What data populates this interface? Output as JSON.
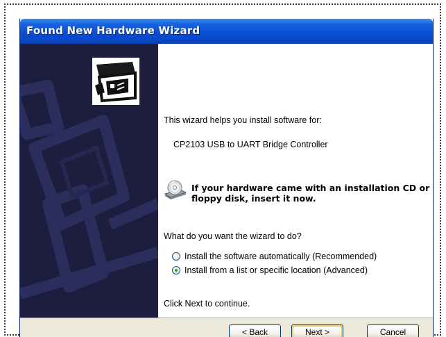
{
  "window": {
    "title": "Found New Hardware Wizard"
  },
  "content": {
    "intro": "This wizard helps you install software for:",
    "device_name": "CP2103 USB to UART Bridge Controller",
    "cd_message": "If your hardware came with an installation CD or floppy disk, insert it now.",
    "question": "What do you want the wizard to do?",
    "options": [
      {
        "label": "Install the software automatically (Recommended)",
        "selected": false
      },
      {
        "label": "Install from a list or specific location (Advanced)",
        "selected": true
      }
    ],
    "continue_hint": "Click Next to continue."
  },
  "buttons": {
    "back": "< Back",
    "next": "Next >",
    "cancel": "Cancel"
  },
  "icons": {
    "hardware": "hardware-card-icon",
    "cd": "cd-drive-icon"
  },
  "colors": {
    "titlebar": "#0a4fd6",
    "sidebar": "#1d1e3e",
    "window_bg": "#ece9d8"
  }
}
